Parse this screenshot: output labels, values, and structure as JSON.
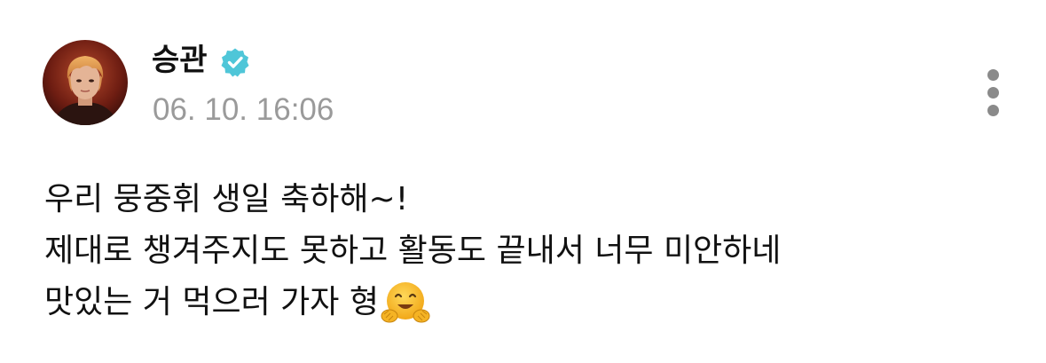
{
  "post": {
    "author": "승관",
    "verified_icon": "verified-badge-icon",
    "timestamp": "06. 10. 16:06",
    "more_icon": "more-vertical-icon",
    "body_lines": [
      "우리 뭉중휘 생일 축하해~!",
      "제대로 챙겨주지도 못하고 활동도 끝내서 너무 미안하네",
      "맛있는 거 먹으러 가자 형"
    ],
    "emoji": "hugging-face-emoji"
  },
  "colors": {
    "text": "#111111",
    "timestamp": "#9a9a9a",
    "verified": "#4fc6d8",
    "more_dots": "#8a8a8a"
  }
}
